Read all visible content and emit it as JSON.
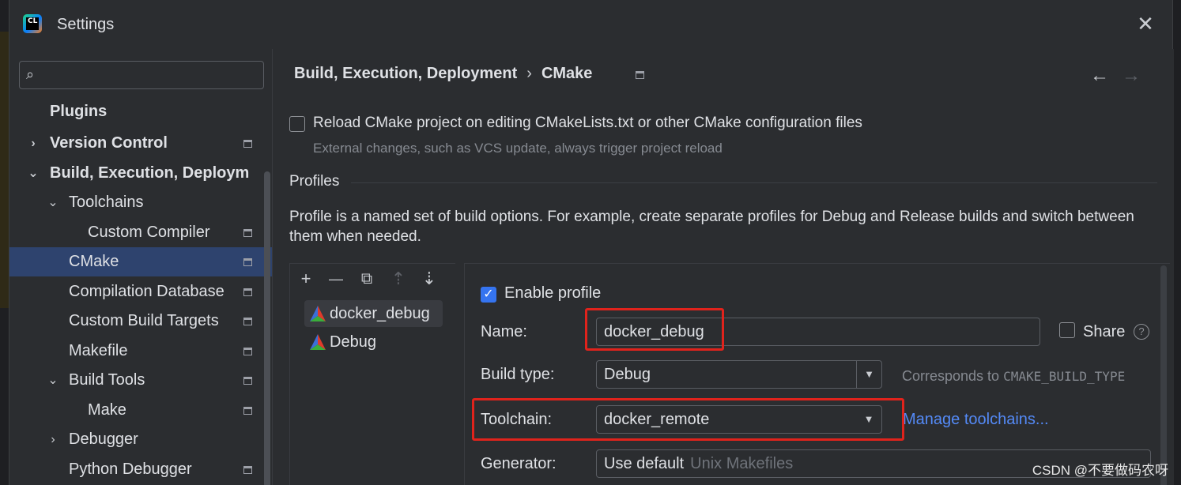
{
  "window": {
    "title": "Settings",
    "logo_text": "CL"
  },
  "sidebar": {
    "search_placeholder": "",
    "items": [
      {
        "label": "Plugins"
      },
      {
        "label": "Version Control"
      },
      {
        "label": "Build, Execution, Deploym"
      },
      {
        "label": "Toolchains"
      },
      {
        "label": "Custom Compiler"
      },
      {
        "label": "CMake"
      },
      {
        "label": "Compilation Database"
      },
      {
        "label": "Custom Build Targets"
      },
      {
        "label": "Makefile"
      },
      {
        "label": "Build Tools"
      },
      {
        "label": "Make"
      },
      {
        "label": "Debugger"
      },
      {
        "label": "Python Debugger"
      }
    ],
    "selected": "CMake"
  },
  "breadcrumb": {
    "parent": "Build, Execution, Deployment",
    "separator": "›",
    "current": "CMake"
  },
  "nav": {
    "back": "←",
    "forward": "→"
  },
  "reload_option": {
    "checked": false,
    "label": "Reload CMake project on editing CMakeLists.txt or other CMake configuration files",
    "hint": "External changes, such as VCS update, always trigger project reload"
  },
  "profiles_section": {
    "title": "Profiles",
    "description": "Profile is a named set of build options. For example, create separate profiles for Debug and Release builds and switch between them when needed.",
    "toolbar": {
      "add": "+",
      "remove": "—",
      "copy": "⧉",
      "up": "⇡",
      "down": "⇣"
    },
    "profiles": [
      {
        "name": "docker_debug",
        "selected": true
      },
      {
        "name": "Debug",
        "selected": false
      }
    ]
  },
  "profile_detail": {
    "enable_checked": true,
    "enable_label": "Enable profile",
    "name_label": "Name:",
    "name_value": "docker_debug",
    "share_label": "Share",
    "share_checked": false,
    "help_glyph": "?",
    "build_type_label": "Build type:",
    "build_type_value": "Debug",
    "build_type_hint_prefix": "Corresponds to ",
    "build_type_hint_code": "CMAKE_BUILD_TYPE",
    "toolchain_label": "Toolchain:",
    "toolchain_value": "docker_remote",
    "manage_link": "Manage toolchains...",
    "generator_label": "Generator:",
    "generator_value": "Use default",
    "generator_placeholder": "Unix Makefiles"
  },
  "watermark": "CSDN @不要做码农呀",
  "colors": {
    "accent": "#3574f0",
    "selection": "#2e436e",
    "link": "#548af7",
    "highlight_box": "#e0231c"
  }
}
